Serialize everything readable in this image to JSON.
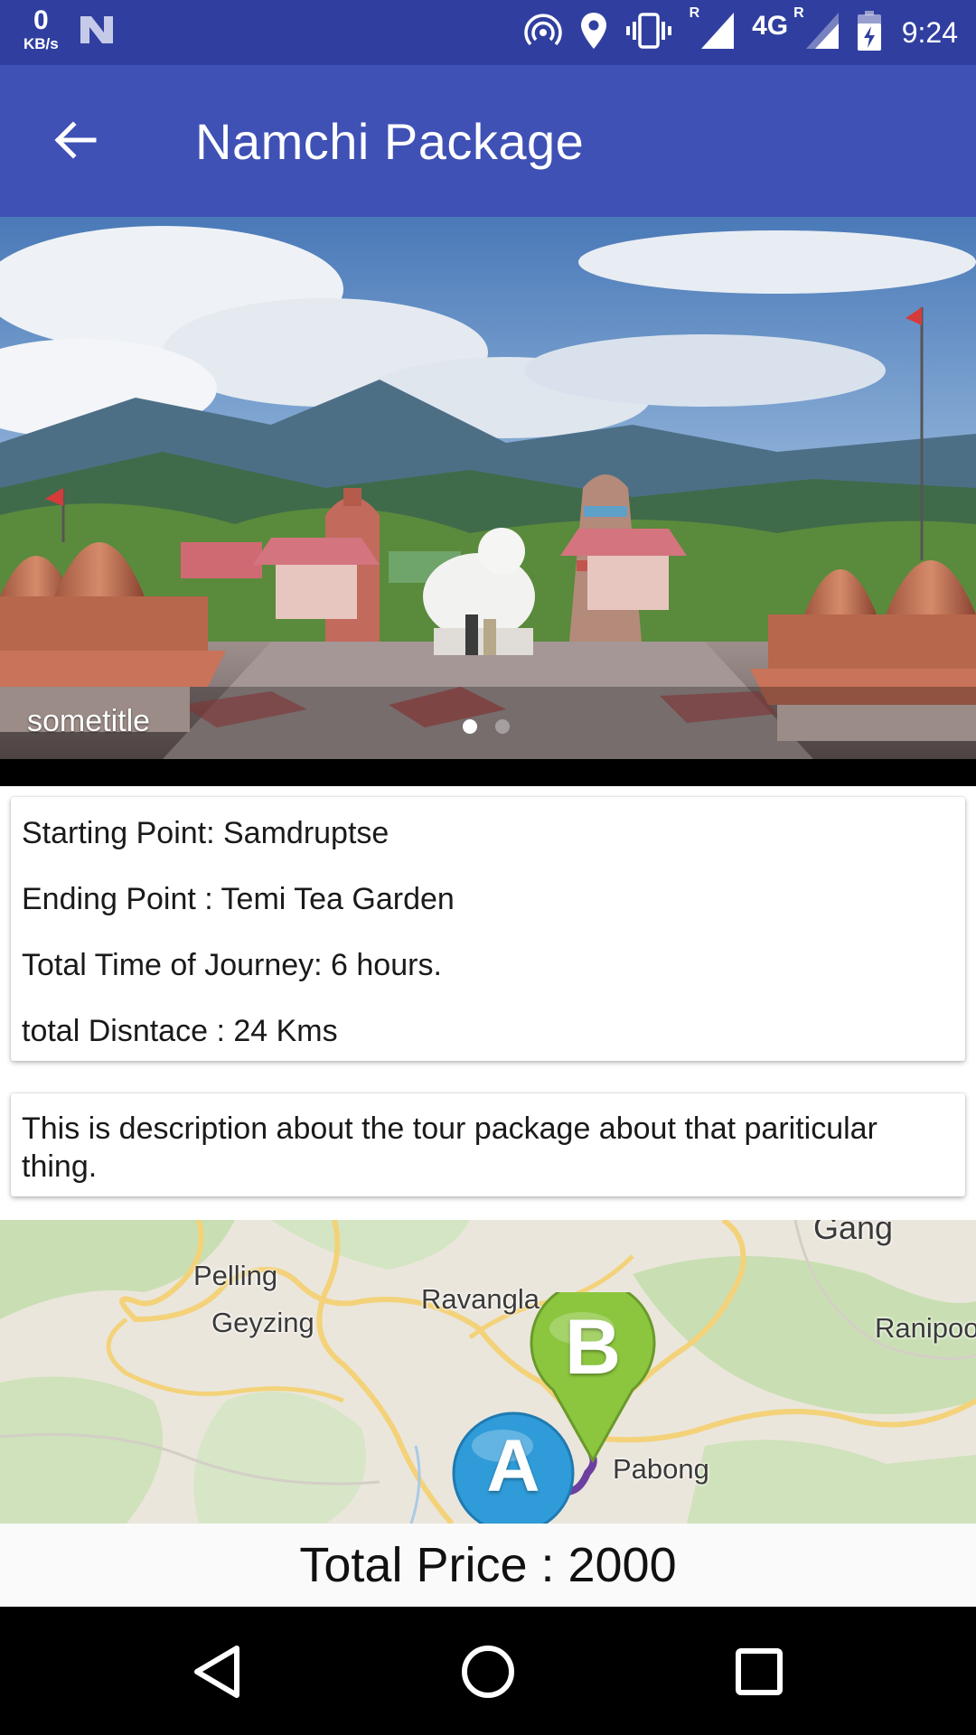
{
  "status_bar": {
    "speed_value": "0",
    "speed_unit": "KB/s",
    "network": "4G",
    "roaming_1": "R",
    "roaming_2": "R",
    "time": "9:24",
    "icons": [
      "hotspot-icon",
      "location-icon",
      "vibrate-icon",
      "signal-icon",
      "battery-icon"
    ]
  },
  "app_bar": {
    "title": "Namchi Package",
    "back_icon": "arrow-back-icon",
    "background": "#3f51b5",
    "status_background": "#303f9f"
  },
  "banner": {
    "caption": "sometitle",
    "slides_total": 2,
    "active_slide": 1
  },
  "details": {
    "starting_point": "Starting Point: Samdruptse",
    "ending_point": "Ending Point : Temi Tea Garden",
    "total_time": "Total Time of Journey: 6 hours.",
    "total_distance": "total Disntace : 24 Kms"
  },
  "description": {
    "text": "This is description about the tour package about that pariticular thing."
  },
  "map": {
    "labels": {
      "pelling": "Pelling",
      "geyzing": "Geyzing",
      "ravangla": "Ravangla",
      "pabong": "Pabong",
      "ranipool": "Ranipoo",
      "gangtok": "Gang"
    },
    "marker_a": "A",
    "marker_b": "B",
    "marker_a_color": "#2f9bd8",
    "marker_b_color": "#8cc63f"
  },
  "price": {
    "text": "Total Price : 2000"
  },
  "nav_bar": {
    "back": "nav-back-icon",
    "home": "nav-home-icon",
    "recents": "nav-recents-icon"
  }
}
